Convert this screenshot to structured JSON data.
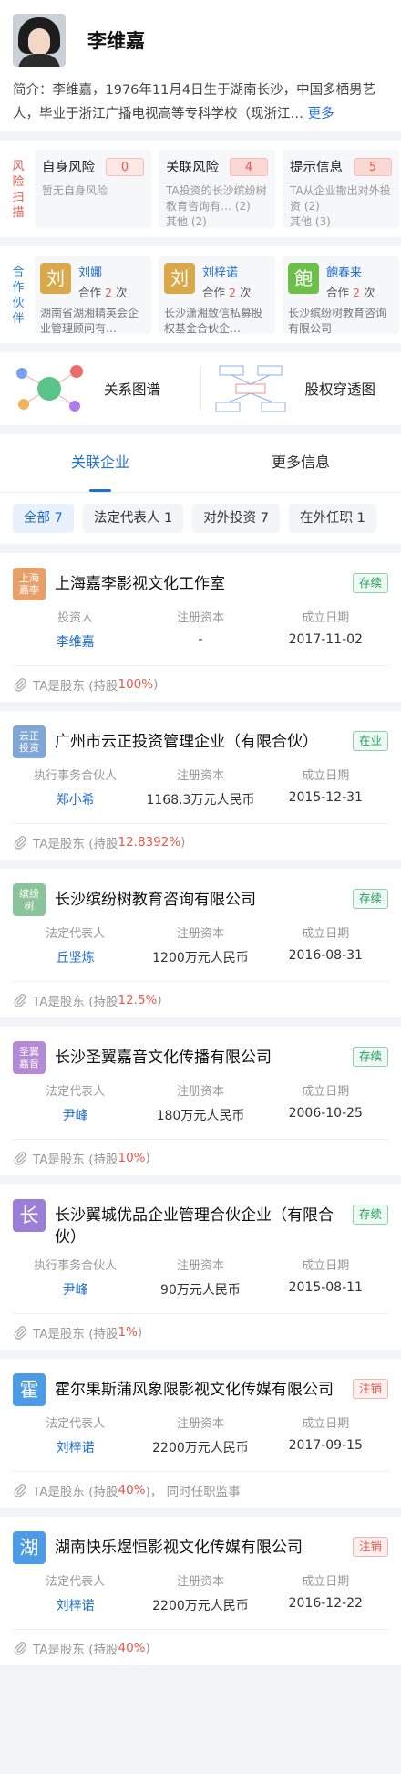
{
  "profile": {
    "name": "李维嘉",
    "intro_label": "简介：",
    "intro_text": "李维嘉，1976年11月4日生于湖南长沙，中国多栖男艺人，毕业于浙江广播电视高等专科学校（现浙江…",
    "more": "更多"
  },
  "risk": {
    "label": "风险扫描",
    "cards": [
      {
        "title": "自身风险",
        "count": "0",
        "desc": "暂无自身风险"
      },
      {
        "title": "关联风险",
        "count": "4",
        "desc": "TA投资的长沙缤纷树教育咨询有… (2)\n其他 (2)"
      },
      {
        "title": "提示信息",
        "count": "5",
        "desc": "TA从企业撤出对外投资 (2)\n其他 (3)"
      }
    ]
  },
  "partners": {
    "label": "合作伙伴",
    "cards": [
      {
        "icon": "刘",
        "name": "刘娜",
        "times_prefix": "合作",
        "times": "2",
        "times_suffix": "次",
        "desc": "湖南省湖湘精英会企业管理顾问有…",
        "color": "#d9a84a"
      },
      {
        "icon": "刘",
        "name": "刘梓诺",
        "times_prefix": "合作",
        "times": "2",
        "times_suffix": "次",
        "desc": "长沙潇湘致信私募股权基金合伙企…",
        "color": "#d9a84a"
      },
      {
        "icon": "飽",
        "name": "飽春来",
        "times_prefix": "合作",
        "times": "2",
        "times_suffix": "次",
        "desc": "长沙缤纷树教育咨询有限公司",
        "color": "#6cc04a"
      }
    ]
  },
  "graphs": {
    "relation": "关系图谱",
    "equity": "股权穿透图"
  },
  "tabs": {
    "active": "关联企业",
    "other": "更多信息"
  },
  "chips": [
    "全部 7",
    "法定代表人 1",
    "对外投资 7",
    "在外任职 1"
  ],
  "companies": [
    {
      "logo": "上海\n嘉李",
      "logo_color": "#e8a06a",
      "name": "上海嘉李影视文化工作室",
      "status": "存续",
      "status_type": "green",
      "l1": "投资人",
      "v1": "李维嘉",
      "l2": "注册资本",
      "v2": "-",
      "l3": "成立日期",
      "v3": "2017-11-02",
      "foot_prefix": "TA是股东 (持股 ",
      "pct": "100%",
      "foot_suffix": ")"
    },
    {
      "logo": "云正\n投资",
      "logo_color": "#7fa6d6",
      "name": "广州市云正投资管理企业（有限合伙）",
      "status": "在业",
      "status_type": "green",
      "l1": "执行事务合伙人",
      "v1": "郑小希",
      "l2": "注册资本",
      "v2": "1168.3万元人民币",
      "l3": "成立日期",
      "v3": "2015-12-31",
      "foot_prefix": "TA是股东 (持股 ",
      "pct": "12.8392%",
      "foot_suffix": ")"
    },
    {
      "logo": "缤纷\n树",
      "logo_color": "#8cc49a",
      "name": "长沙缤纷树教育咨询有限公司",
      "status": "存续",
      "status_type": "green",
      "l1": "法定代表人",
      "v1": "丘坚炼",
      "l2": "注册资本",
      "v2": "1200万元人民币",
      "l3": "成立日期",
      "v3": "2016-08-31",
      "foot_prefix": "TA是股东 (持股 ",
      "pct": "12.5%",
      "foot_suffix": ")"
    },
    {
      "logo": "圣翼\n嘉音",
      "logo_color": "#b48ad6",
      "name": "长沙圣翼嘉音文化传播有限公司",
      "status": "存续",
      "status_type": "green",
      "l1": "法定代表人",
      "v1": "尹峰",
      "l2": "注册资本",
      "v2": "180万元人民币",
      "l3": "成立日期",
      "v3": "2006-10-25",
      "foot_prefix": "TA是股东 (持股 ",
      "pct": "10%",
      "foot_suffix": ")"
    },
    {
      "logo": "长",
      "logo_color": "#9b7fd6",
      "name": "长沙翼城优品企业管理合伙企业（有限合伙）",
      "status": "存续",
      "status_type": "green",
      "l1": "执行事务合伙人",
      "v1": "尹峰",
      "l2": "注册资本",
      "v2": "90万元人民币",
      "l3": "成立日期",
      "v3": "2015-08-11",
      "foot_prefix": "TA是股东 (持股 ",
      "pct": "1%",
      "foot_suffix": ")"
    },
    {
      "logo": "霍",
      "logo_color": "#4b9be6",
      "name": "霍尔果斯蒲风象限影视文化传媒有限公司",
      "status": "注销",
      "status_type": "red",
      "l1": "法定代表人",
      "v1": "刘梓诺",
      "l2": "注册资本",
      "v2": "2200万元人民币",
      "l3": "成立日期",
      "v3": "2017-09-15",
      "foot_prefix": "TA是股东 (持股 ",
      "pct": "40%",
      "foot_suffix": ")， 同时任职监事"
    },
    {
      "logo": "湖",
      "logo_color": "#4b9be6",
      "name": "湖南快乐煜恒影视文化传媒有限公司",
      "status": "注销",
      "status_type": "red",
      "l1": "法定代表人",
      "v1": "刘梓诺",
      "l2": "注册资本",
      "v2": "2200万元人民币",
      "l3": "成立日期",
      "v3": "2016-12-22",
      "foot_prefix": "TA是股东 (持股 ",
      "pct": "40%",
      "foot_suffix": ")"
    }
  ]
}
